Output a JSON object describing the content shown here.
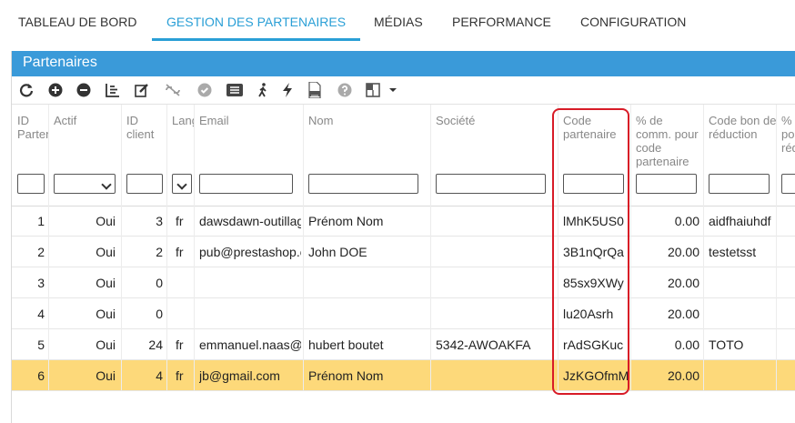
{
  "tabs": [
    {
      "label": "TABLEAU DE BORD"
    },
    {
      "label": "GESTION DES PARTENAIRES",
      "active": true
    },
    {
      "label": "MÉDIAS"
    },
    {
      "label": "PERFORMANCE"
    },
    {
      "label": "CONFIGURATION"
    }
  ],
  "panel": {
    "title": "Partenaires"
  },
  "toolbar_icons": [
    "refresh-icon",
    "add-icon",
    "remove-icon",
    "bar-chart-icon",
    "edit-icon",
    "unlink-icon",
    "check-icon",
    "list-icon",
    "walk-icon",
    "lightning-icon",
    "csv-export-icon",
    "help-icon",
    "layout-icon",
    "caret-down-icon"
  ],
  "columns": {
    "id_partner": "ID Partenaire",
    "actif": "Actif",
    "id_client": "ID client",
    "langue": "Langue",
    "email": "Email",
    "nom": "Nom",
    "societe": "Société",
    "code": "Code partenaire",
    "comm": "% de comm. pour code partenaire",
    "bon": "Code bon de réduction",
    "pct": "% pour réd"
  },
  "rows": [
    {
      "id": "1",
      "actif": "Oui",
      "client": "3",
      "lang": "fr",
      "email": "dawsdawn-outillage",
      "nom": "Prénom Nom",
      "societe": "",
      "code": "lMhK5US0",
      "comm": "0.00",
      "bon": "aidfhaiuhdf"
    },
    {
      "id": "2",
      "actif": "Oui",
      "client": "2",
      "lang": "fr",
      "email": "pub@prestashop.com",
      "nom": "John DOE",
      "societe": "",
      "code": "3B1nQrQa",
      "comm": "20.00",
      "bon": "testetsst"
    },
    {
      "id": "3",
      "actif": "Oui",
      "client": "0",
      "lang": "",
      "email": "",
      "nom": "",
      "societe": "",
      "code": "85sx9XWy",
      "comm": "20.00",
      "bon": ""
    },
    {
      "id": "4",
      "actif": "Oui",
      "client": "0",
      "lang": "",
      "email": "",
      "nom": "",
      "societe": "",
      "code": "lu20Asrh",
      "comm": "20.00",
      "bon": ""
    },
    {
      "id": "5",
      "actif": "Oui",
      "client": "24",
      "lang": "fr",
      "email": "emmanuel.naas@",
      "nom": "hubert boutet",
      "societe": "5342-AWOAKFA",
      "code": "rAdSGKuc",
      "comm": "0.00",
      "bon": "TOTO"
    },
    {
      "id": "6",
      "actif": "Oui",
      "client": "4",
      "lang": "fr",
      "email": "jb@gmail.com",
      "nom": "Prénom Nom",
      "societe": "",
      "code": "JzKGOfmM",
      "comm": "20.00",
      "bon": "",
      "selected": true
    }
  ],
  "colors": {
    "accent": "#2a9fd6",
    "panel": "#3a9ad9",
    "selected_row": "#fdd97a",
    "highlight": "#d81b27"
  }
}
